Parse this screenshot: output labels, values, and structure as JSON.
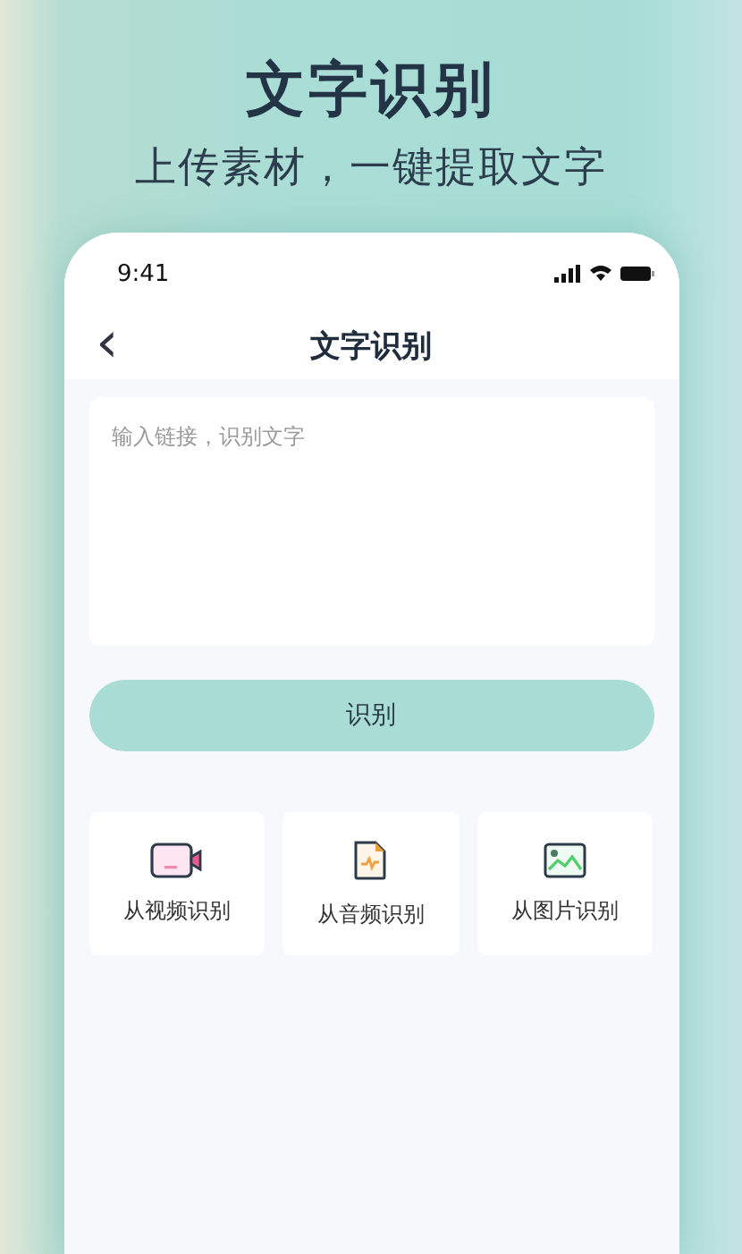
{
  "headline": "文字识别",
  "subtitle": "上传素材，一键提取文字",
  "status_bar": {
    "time": "9:41"
  },
  "nav": {
    "back": "‹",
    "title": "文字识别"
  },
  "link_field": {
    "placeholder": "输入链接，识别文字"
  },
  "submit_button": "识别",
  "sources": [
    {
      "kind": "video",
      "label": "从视频识别"
    },
    {
      "kind": "audio",
      "label": "从音频识别"
    },
    {
      "kind": "image",
      "label": "从图片识别"
    }
  ]
}
